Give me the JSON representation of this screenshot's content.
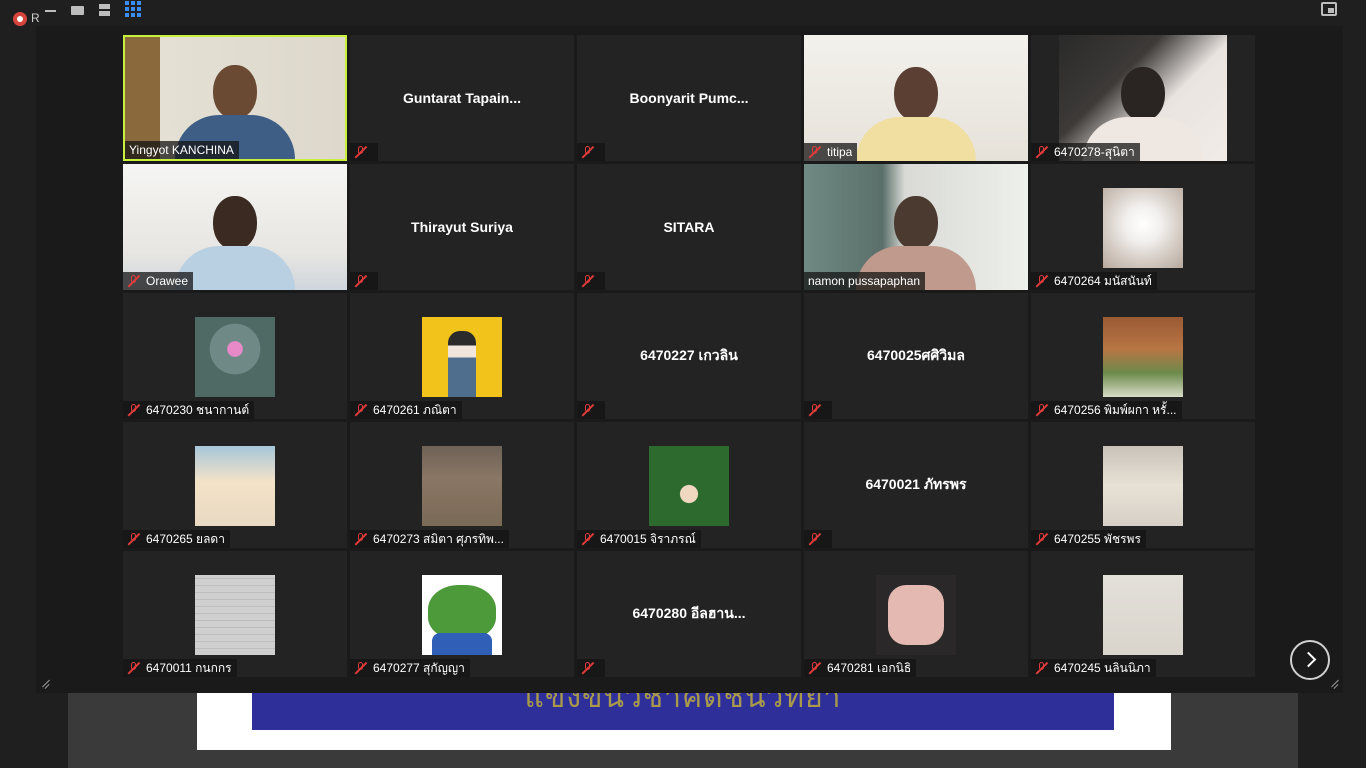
{
  "top_bar": {
    "record_label": "R",
    "icons": [
      "minimize-icon",
      "filmstrip-view-icon",
      "speaker-view-icon",
      "gallery-view-icon",
      "exit-fullscreen-icon"
    ]
  },
  "background_share": {
    "banner_text": "แข่งขันวิชาคิดชินวิทยา"
  },
  "colors": {
    "active_speaker_border": "#c8f03c",
    "tile_bg": "#232323",
    "mute_icon": "#e03b3b",
    "gallery_icon": "#3a8df5"
  },
  "participants": [
    {
      "name": "Yingyot KANCHINA",
      "muted": false,
      "video": true,
      "active": true
    },
    {
      "name": "Guntarat  Tapain...",
      "muted": true,
      "video": false
    },
    {
      "name": "Boonyarit  Pumc...",
      "muted": true,
      "video": false
    },
    {
      "name": "titipa",
      "muted": true,
      "video": true
    },
    {
      "name": "6470278-สุนิตา",
      "muted": true,
      "video": true
    },
    {
      "name": "Orawee",
      "muted": true,
      "video": true
    },
    {
      "name": "Thirayut Suriya",
      "muted": true,
      "video": false
    },
    {
      "name": "SITARA",
      "muted": true,
      "video": false
    },
    {
      "name": "namon pussapaphan",
      "muted": false,
      "video": true
    },
    {
      "name": "6470264 มนัสนันท์",
      "muted": true,
      "video": false,
      "photo": "dog"
    },
    {
      "name": "6470230 ชนากานต์",
      "muted": true,
      "video": false,
      "photo": "owl"
    },
    {
      "name": "6470261 ภณิตา",
      "muted": true,
      "video": false,
      "photo": "yellow"
    },
    {
      "name": "6470227 เกวลิน",
      "muted": true,
      "video": false
    },
    {
      "name": "6470025ศศิวิมล",
      "muted": true,
      "video": false
    },
    {
      "name": "6470256 พิมพ์ผกา หรั้...",
      "muted": true,
      "video": false,
      "photo": "hut"
    },
    {
      "name": "6470265 ยลดา",
      "muted": true,
      "video": false,
      "photo": "girl"
    },
    {
      "name": "6470273 สมิตา ศุภรทิพ...",
      "muted": true,
      "video": false,
      "photo": "dogs"
    },
    {
      "name": "6470015 จิราภรณ์",
      "muted": true,
      "video": false,
      "photo": "leaves"
    },
    {
      "name": "6470021 ภัทรพร",
      "muted": true,
      "video": false
    },
    {
      "name": "6470255 พัชรพร",
      "muted": true,
      "video": false,
      "photo": "room"
    },
    {
      "name": "6470011 กนกกร",
      "muted": true,
      "video": false,
      "photo": "wall"
    },
    {
      "name": "6470277 สุกัญญา",
      "muted": true,
      "video": false,
      "photo": "pepe"
    },
    {
      "name": "6470280 อีลฮาน...",
      "muted": true,
      "video": false
    },
    {
      "name": "6470281 เอกนิธิ",
      "muted": true,
      "video": false,
      "photo": "cooker"
    },
    {
      "name": "6470245 นลินนิภา",
      "muted": true,
      "video": false,
      "photo": "paper"
    }
  ]
}
